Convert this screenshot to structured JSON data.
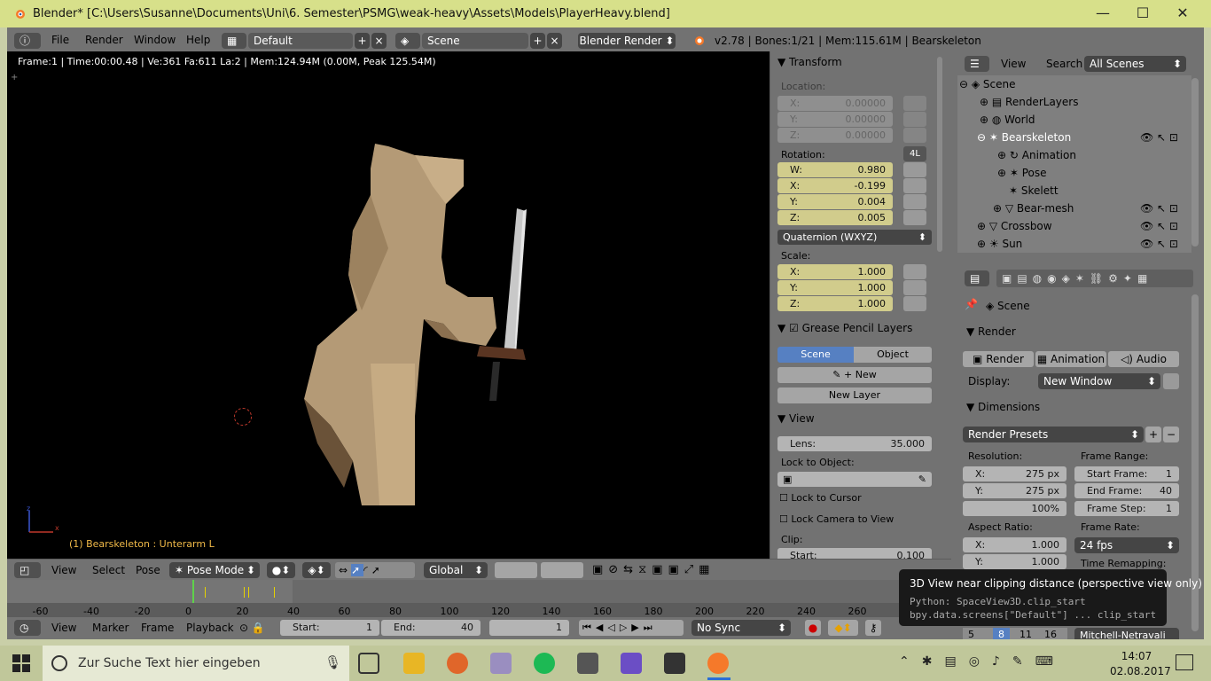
{
  "window": {
    "title": "Blender* [C:\\Users\\Susanne\\Documents\\Uni\\6. Semester\\PSMG\\weak-heavy\\Assets\\Models\\PlayerHeavy.blend]",
    "minimize": "—",
    "maximize": "☐",
    "close": "✕"
  },
  "menubar": {
    "file": "File",
    "render": "Render",
    "window": "Window",
    "help": "Help",
    "screen_layout": "Default",
    "scene": "Scene",
    "engine": "Blender Render",
    "stats": "v2.78 | Bones:1/21 | Mem:115.61M | Bearskeleton"
  },
  "viewport": {
    "info": "Frame:1 | Time:00:00.48 | Ve:361 Fa:611 La:2 | Mem:124.94M (0.00M, Peak 125.54M)",
    "object_label": "(1) Bearskeleton : Unterarm L"
  },
  "npanel": {
    "transform_title": "Transform",
    "location_label": "Location:",
    "location": [
      {
        "k": "X:",
        "v": "0.00000"
      },
      {
        "k": "Y:",
        "v": "0.00000"
      },
      {
        "k": "Z:",
        "v": "0.00000"
      }
    ],
    "rotation_label": "Rotation:",
    "rotation_lock": "4L",
    "rotation": [
      {
        "k": "W:",
        "v": "0.980"
      },
      {
        "k": "X:",
        "v": "-0.199"
      },
      {
        "k": "Y:",
        "v": "0.004"
      },
      {
        "k": "Z:",
        "v": "0.005"
      }
    ],
    "rotation_mode": "Quaternion (WXYZ)",
    "scale_label": "Scale:",
    "scale": [
      {
        "k": "X:",
        "v": "1.000"
      },
      {
        "k": "Y:",
        "v": "1.000"
      },
      {
        "k": "Z:",
        "v": "1.000"
      }
    ],
    "grease_title": "Grease Pencil Layers",
    "gp_scene": "Scene",
    "gp_object": "Object",
    "gp_new": "New",
    "gp_new_layer": "New Layer",
    "view_title": "View",
    "lens_label": "Lens:",
    "lens_value": "35.000",
    "lock_to_object": "Lock to Object:",
    "lock_to_cursor": "Lock to Cursor",
    "lock_camera": "Lock Camera to View",
    "clip_label": "Clip:",
    "clip_start": "Start:",
    "clip_start_value": "0.100"
  },
  "outliner": {
    "view": "View",
    "search": "Search",
    "filter": "All Scenes",
    "rows": [
      {
        "label": "Scene",
        "indent": 0
      },
      {
        "label": "RenderLayers",
        "indent": 1
      },
      {
        "label": "World",
        "indent": 1
      },
      {
        "label": "Bearskeleton",
        "indent": 1
      },
      {
        "label": "Animation",
        "indent": 2
      },
      {
        "label": "Pose",
        "indent": 2
      },
      {
        "label": "Skelett",
        "indent": 2
      },
      {
        "label": "Bear-mesh",
        "indent": 2
      },
      {
        "label": "Crossbow",
        "indent": 1
      },
      {
        "label": "Sun",
        "indent": 1
      }
    ]
  },
  "properties": {
    "context": "Scene",
    "render_title": "Render",
    "btn_render": "Render",
    "btn_animation": "Animation",
    "btn_audio": "Audio",
    "display_label": "Display:",
    "display_value": "New Window",
    "dimensions_title": "Dimensions",
    "presets": "Render Presets",
    "resolution_label": "Resolution:",
    "res_x_k": "X:",
    "res_x": "275 px",
    "res_y_k": "Y:",
    "res_y": "275 px",
    "res_pct": "100%",
    "frame_range_label": "Frame Range:",
    "start_frame_k": "Start Frame:",
    "start_frame": "1",
    "end_frame_k": "End Frame:",
    "end_frame": "40",
    "frame_step_k": "Frame Step:",
    "frame_step": "1",
    "aspect_label": "Aspect Ratio:",
    "aspect_x_k": "X:",
    "aspect_x": "1.000",
    "aspect_y_k": "Y:",
    "aspect_y": "1.000",
    "frame_rate_label": "Frame Rate:",
    "frame_rate": "24 fps",
    "time_remap": "Time Remapping:",
    "bottom_nums": [
      "5",
      "8",
      "11",
      "16"
    ],
    "bottom_text": "Mitchell-Netravali"
  },
  "view3d_header": {
    "view": "View",
    "select": "Select",
    "pose": "Pose",
    "mode": "Pose Mode",
    "orientation": "Global"
  },
  "timeline": {
    "ticks": [
      "-60",
      "-40",
      "-20",
      "0",
      "20",
      "40",
      "60",
      "80",
      "100",
      "120",
      "140",
      "160",
      "180",
      "200",
      "220",
      "240",
      "260"
    ],
    "current_frame": 0,
    "keyframes": [
      0,
      5,
      20,
      22,
      32
    ]
  },
  "timeline_header": {
    "view": "View",
    "marker": "Marker",
    "frame": "Frame",
    "playback": "Playback",
    "start_label": "Start:",
    "start": "1",
    "end_label": "End:",
    "end": "40",
    "current": "1",
    "sync": "No Sync"
  },
  "tooltip": {
    "title": "3D View near clipping distance (perspective view only)",
    "python1": "Python: SpaceView3D.clip_start",
    "python2": "bpy.data.screens[\"Default\"] ... clip_start"
  },
  "taskbar": {
    "search_placeholder": "Zur Suche Text hier eingeben",
    "time": "14:07",
    "date": "02.08.2017"
  }
}
